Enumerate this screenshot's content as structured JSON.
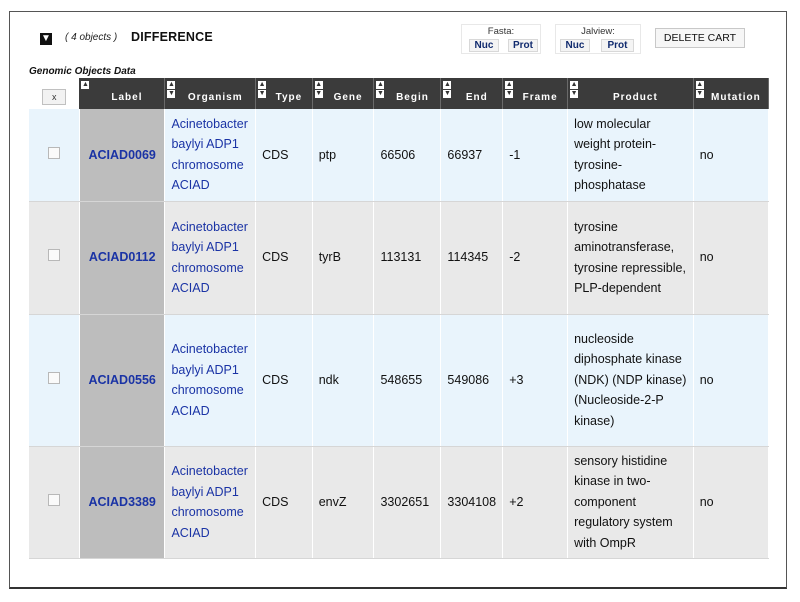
{
  "cart": {
    "toggle_icon": "collapse-arrow-icon",
    "object_count": "( 4 objects )",
    "name": "DIFFERENCE",
    "fasta": {
      "label": "Fasta:",
      "nuc": "Nuc",
      "prot": "Prot"
    },
    "jalview": {
      "label": "Jalview:",
      "nuc": "Nuc",
      "prot": "Prot"
    },
    "delete_label": "DELETE CART"
  },
  "section_title": "Genomic Objects Data",
  "table": {
    "clear_button": "x",
    "columns": [
      "Label",
      "Organism",
      "Type",
      "Gene",
      "Begin",
      "End",
      "Frame",
      "Product",
      "Mutation"
    ],
    "rows": [
      {
        "label": "ACIAD0069",
        "organism": "Acinetobacter baylyi ADP1 chromosome ACIAD",
        "type": "CDS",
        "gene": "ptp",
        "begin": "66506",
        "end": "66937",
        "frame": "-1",
        "product": "low molecular weight protein-tyrosine-phosphatase",
        "mutation": "no"
      },
      {
        "label": "ACIAD0112",
        "organism": "Acinetobacter baylyi ADP1 chromosome ACIAD",
        "type": "CDS",
        "gene": "tyrB",
        "begin": "113131",
        "end": "114345",
        "frame": "-2",
        "product": "tyrosine aminotransferase, tyrosine repressible, PLP-dependent",
        "mutation": "no"
      },
      {
        "label": "ACIAD0556",
        "organism": "Acinetobacter baylyi ADP1 chromosome ACIAD",
        "type": "CDS",
        "gene": "ndk",
        "begin": "548655",
        "end": "549086",
        "frame": "+3",
        "product": "nucleoside diphosphate kinase (NDK) (NDP kinase) (Nucleoside-2-P kinase)",
        "mutation": "no"
      },
      {
        "label": "ACIAD3389",
        "organism": "Acinetobacter baylyi ADP1 chromosome ACIAD",
        "type": "CDS",
        "gene": "envZ",
        "begin": "3302651",
        "end": "3304108",
        "frame": "+2",
        "product": "sensory histidine kinase in two-component regulatory system with OmpR",
        "mutation": "no"
      }
    ]
  },
  "colors": {
    "header_bg": "#3b3b3b",
    "row_odd": "#e9f4fc",
    "row_even": "#e9e9e9",
    "label_cell": "#bdbdbd",
    "link": "#1a33a5"
  }
}
